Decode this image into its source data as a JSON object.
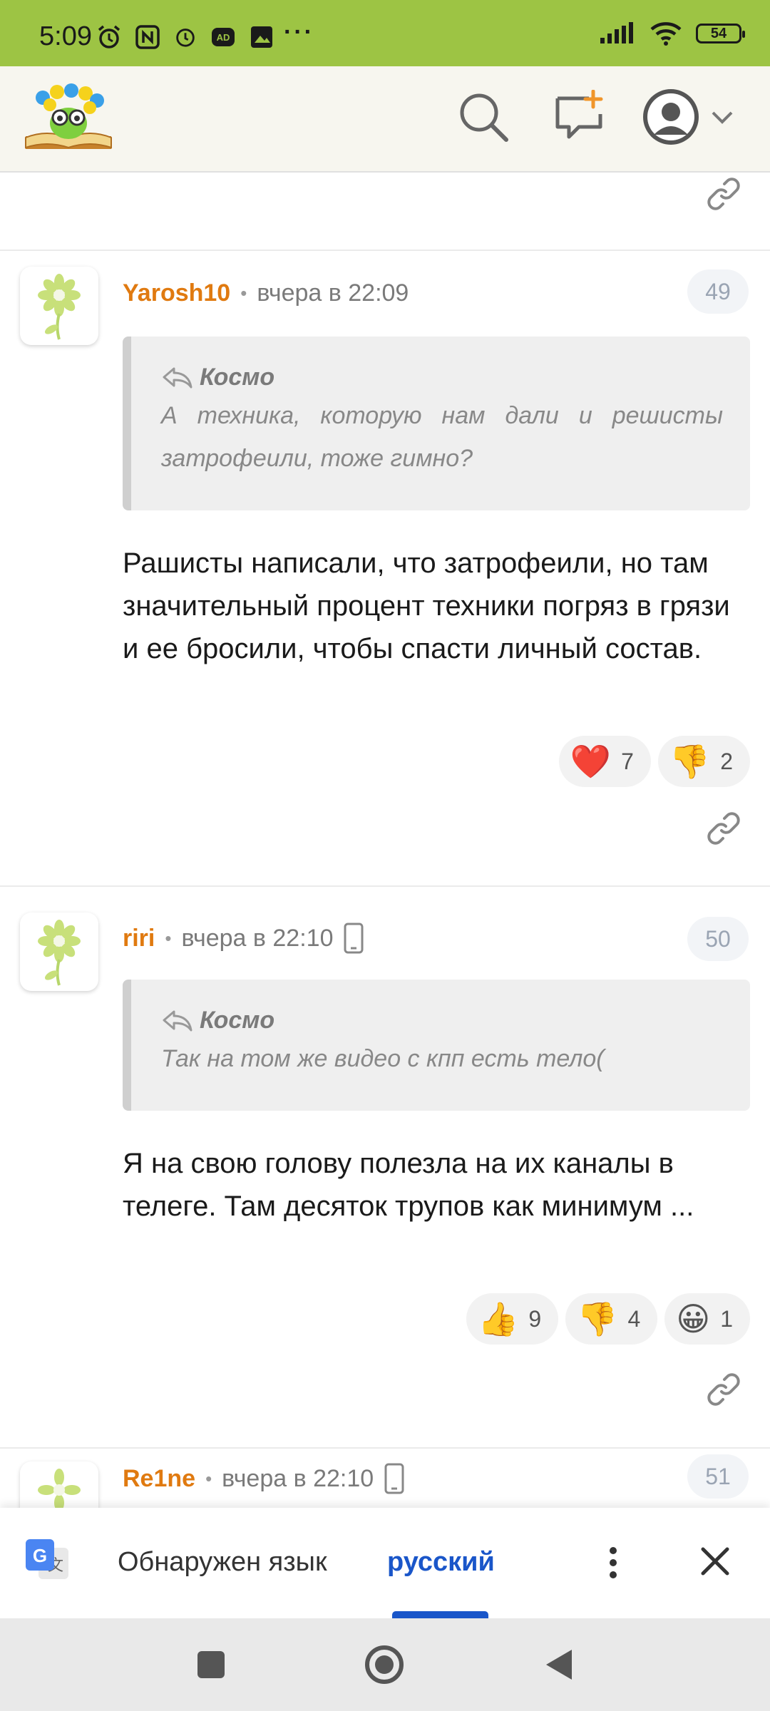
{
  "status_bar": {
    "time": "5:09",
    "battery": "54",
    "more_dots": "···"
  },
  "header": {
    "search_icon": "search-icon",
    "new_post_icon": "new-post-icon",
    "avatar_icon": "user-avatar-icon"
  },
  "comments": [
    {
      "author": "Yarosh10",
      "time": "вчера в 22:09",
      "number": "49",
      "quote_author": "Космо",
      "quote_text": "А техника, которую нам дали и решисты затрофеили, тоже гимно?",
      "body": "Рашисты написали, что затрофеили, но там значительный процент техники погряз в грязи и ее бросили, чтобы спасти личный состав.",
      "reactions": [
        {
          "emoji": "❤️",
          "count": "7"
        },
        {
          "emoji": "👎",
          "count": "2"
        }
      ]
    },
    {
      "author": "riri",
      "time": "вчера в 22:10",
      "number": "50",
      "quote_author": "Космо",
      "quote_text": "Так на том же видео с кпп есть тело(",
      "body": "Я на свою голову полезла на их каналы в телеге. Там десяток трупов как минимум ...",
      "reactions": [
        {
          "emoji": "👍",
          "count": "9"
        },
        {
          "emoji": "👎",
          "count": "4"
        },
        {
          "emoji": "😀",
          "count": "1"
        }
      ]
    },
    {
      "author": "Re1ne",
      "time": "вчера в 22:10",
      "number": "51"
    }
  ],
  "translate_bar": {
    "label": "Обнаружен язык",
    "language": "русский"
  },
  "colors": {
    "status_bar": "#9dc444",
    "author": "#e07a10",
    "translate_accent": "#1a56c9"
  }
}
